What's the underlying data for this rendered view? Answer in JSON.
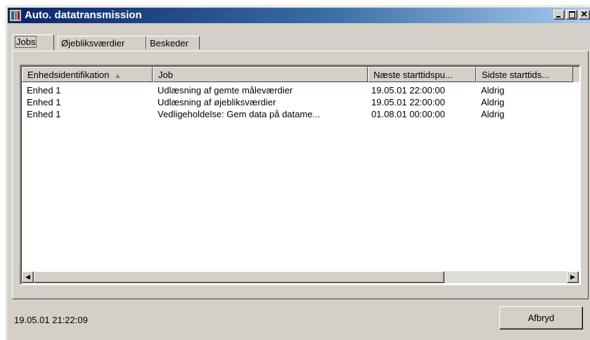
{
  "window": {
    "title": "Auto. datatransmission",
    "controls": {
      "minimize_icon": "minimize-icon",
      "maximize_icon": "maximize-icon",
      "close_icon": "close-icon"
    }
  },
  "tabs": [
    {
      "label": "Jobs",
      "active": true
    },
    {
      "label": "Øjebliksværdier",
      "active": false
    },
    {
      "label": "Beskeder",
      "active": false
    }
  ],
  "table": {
    "columns": [
      {
        "label": "Enhedsidentifikation",
        "sort_icon": "▲"
      },
      {
        "label": "Job"
      },
      {
        "label": "Næste starttidspu..."
      },
      {
        "label": "Sidste starttids..."
      }
    ],
    "rows": [
      {
        "device": "Enhed 1",
        "job": "Udlæsning af gemte måleværdier",
        "next_start": "19.05.01  22:00:00",
        "last_start": "Aldrig"
      },
      {
        "device": "Enhed 1",
        "job": "Udlæsning af øjebliksværdier",
        "next_start": "19.05.01  22:00:00",
        "last_start": "Aldrig"
      },
      {
        "device": "Enhed 1",
        "job": "Vedligeholdelse: Gem data på datame...",
        "next_start": "01.08.01  00:00:00",
        "last_start": "Aldrig"
      }
    ],
    "scroll_left": "◀",
    "scroll_right": "▶"
  },
  "status": {
    "timestamp": "19.05.01  21:22:09"
  },
  "buttons": {
    "cancel": "Afbryd"
  },
  "colors": {
    "titlebar_start": "#0a246a",
    "titlebar_end": "#a6caf0",
    "face": "#d4d0c8"
  }
}
